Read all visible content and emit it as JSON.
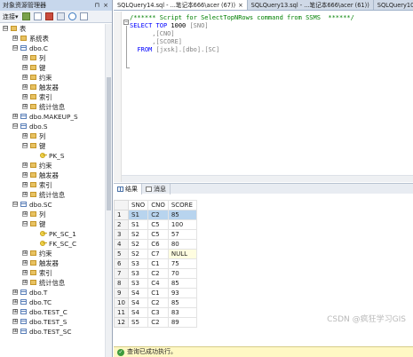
{
  "explorer": {
    "title": "对象资源管理器",
    "title_pin": "⊓",
    "title_close": "×",
    "connect_label": "连接▾",
    "tree": [
      {
        "level": 0,
        "exp": "⊟",
        "icon": "folder",
        "label": "表"
      },
      {
        "level": 1,
        "exp": "⊞",
        "icon": "folder",
        "label": "系统表"
      },
      {
        "level": 1,
        "exp": "⊟",
        "icon": "table",
        "label": "dbo.C"
      },
      {
        "level": 2,
        "exp": "⊞",
        "icon": "folder",
        "label": "列"
      },
      {
        "level": 2,
        "exp": "⊞",
        "icon": "folder",
        "label": "键"
      },
      {
        "level": 2,
        "exp": "⊞",
        "icon": "folder",
        "label": "约束"
      },
      {
        "level": 2,
        "exp": "⊞",
        "icon": "folder",
        "label": "触发器"
      },
      {
        "level": 2,
        "exp": "⊞",
        "icon": "folder",
        "label": "索引"
      },
      {
        "level": 2,
        "exp": "⊞",
        "icon": "folder",
        "label": "统计信息"
      },
      {
        "level": 1,
        "exp": "⊞",
        "icon": "table",
        "label": "dbo.MAKEUP_S"
      },
      {
        "level": 1,
        "exp": "⊟",
        "icon": "table",
        "label": "dbo.S"
      },
      {
        "level": 2,
        "exp": "⊞",
        "icon": "folder",
        "label": "列"
      },
      {
        "level": 2,
        "exp": "⊟",
        "icon": "folder",
        "label": "键"
      },
      {
        "level": 3,
        "exp": "",
        "icon": "key",
        "label": "PK_S"
      },
      {
        "level": 2,
        "exp": "⊞",
        "icon": "folder",
        "label": "约束"
      },
      {
        "level": 2,
        "exp": "⊞",
        "icon": "folder",
        "label": "触发器"
      },
      {
        "level": 2,
        "exp": "⊞",
        "icon": "folder",
        "label": "索引"
      },
      {
        "level": 2,
        "exp": "⊞",
        "icon": "folder",
        "label": "统计信息"
      },
      {
        "level": 1,
        "exp": "⊟",
        "icon": "table",
        "label": "dbo.SC"
      },
      {
        "level": 2,
        "exp": "⊞",
        "icon": "folder",
        "label": "列"
      },
      {
        "level": 2,
        "exp": "⊟",
        "icon": "folder",
        "label": "键"
      },
      {
        "level": 3,
        "exp": "",
        "icon": "key",
        "label": "PK_SC_1"
      },
      {
        "level": 3,
        "exp": "",
        "icon": "key",
        "label": "FK_SC_C"
      },
      {
        "level": 2,
        "exp": "⊞",
        "icon": "folder",
        "label": "约束"
      },
      {
        "level": 2,
        "exp": "⊞",
        "icon": "folder",
        "label": "触发器"
      },
      {
        "level": 2,
        "exp": "⊞",
        "icon": "folder",
        "label": "索引"
      },
      {
        "level": 2,
        "exp": "⊞",
        "icon": "folder",
        "label": "统计信息"
      },
      {
        "level": 1,
        "exp": "⊞",
        "icon": "table",
        "label": "dbo.T"
      },
      {
        "level": 1,
        "exp": "⊞",
        "icon": "table",
        "label": "dbo.TC"
      },
      {
        "level": 1,
        "exp": "⊞",
        "icon": "table",
        "label": "dbo.TEST_C"
      },
      {
        "level": 1,
        "exp": "⊞",
        "icon": "table",
        "label": "dbo.TEST_S"
      },
      {
        "level": 1,
        "exp": "⊞",
        "icon": "table",
        "label": "dbo.TEST_SC"
      }
    ]
  },
  "tabs": [
    {
      "label": "SQLQuery14.sql - ...笔记本666\\acer (67))",
      "close": "×",
      "active": true
    },
    {
      "label": "SQLQuery13.sql - ...笔记本666\\acer (61))",
      "close": "",
      "active": false
    },
    {
      "label": "SQLQuery10.sql",
      "close": "",
      "active": false
    }
  ],
  "editor": {
    "collapse_glyph": "−",
    "lines": [
      {
        "text": "/****** Script for SelectTopNRows command from SSMS  ******/"
      },
      {
        "text": "SELECT TOP 1000 [SNO]"
      },
      {
        "text": "      ,[CNO]"
      },
      {
        "text": "      ,[SCORE]"
      },
      {
        "text": "  FROM [jxsk].[dbo].[SC]"
      }
    ]
  },
  "results": {
    "tab_results": "结果",
    "tab_messages": "消息",
    "columns": [
      "SNO",
      "CNO",
      "SCORE"
    ],
    "rows": [
      [
        "1",
        "S1",
        "C2",
        "85"
      ],
      [
        "2",
        "S1",
        "C5",
        "100"
      ],
      [
        "3",
        "S2",
        "C5",
        "57"
      ],
      [
        "4",
        "S2",
        "C6",
        "80"
      ],
      [
        "5",
        "S2",
        "C7",
        "NULL"
      ],
      [
        "6",
        "S3",
        "C1",
        "75"
      ],
      [
        "7",
        "S3",
        "C2",
        "70"
      ],
      [
        "8",
        "S3",
        "C4",
        "85"
      ],
      [
        "9",
        "S4",
        "C1",
        "93"
      ],
      [
        "10",
        "S4",
        "C2",
        "85"
      ],
      [
        "11",
        "S4",
        "C3",
        "83"
      ],
      [
        "12",
        "S5",
        "C2",
        "89"
      ]
    ]
  },
  "status": {
    "text": "查询已成功执行。",
    "icon": "✓"
  },
  "watermark": "CSDN @疯狂学习GIS"
}
